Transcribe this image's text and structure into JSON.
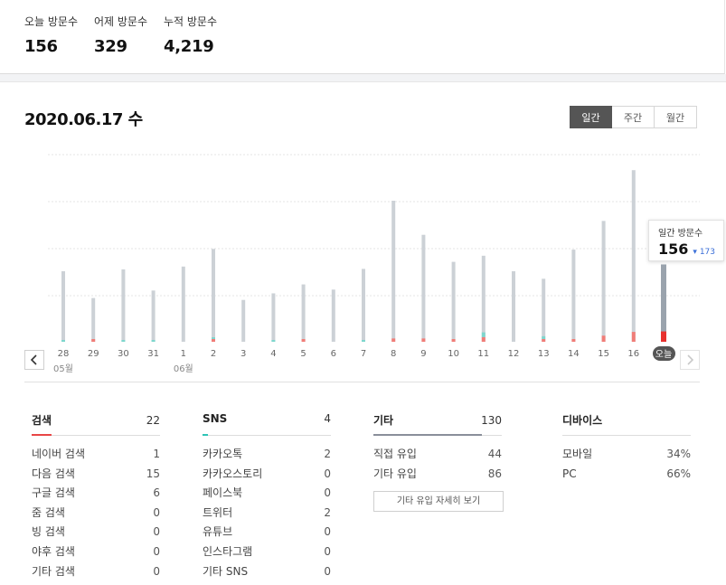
{
  "summary": {
    "today_label": "오늘 방문수",
    "today_value": "156",
    "yesterday_label": "어제 방문수",
    "yesterday_value": "329",
    "total_label": "누적 방문수",
    "total_value": "4,219"
  },
  "date_title": "2020.06.17 수",
  "period_tabs": [
    {
      "label": "일간",
      "active": true
    },
    {
      "label": "주간",
      "active": false
    },
    {
      "label": "월간",
      "active": false
    }
  ],
  "tooltip": {
    "label": "일간 방문수",
    "value": "156",
    "delta": "173",
    "delta_icon": "caret-down-icon"
  },
  "colors": {
    "bar_total": "#ccd1d6",
    "bar_today": "#9aa3ad",
    "bar_red": "#f07d78",
    "bar_red_today": "#e8312e",
    "bar_teal": "#7fd6cd",
    "accent_search": "#e84646",
    "accent_sns": "#2ec4b6",
    "accent_other": "#8a8f9a"
  },
  "chart_data": {
    "type": "bar",
    "categories": [
      "28",
      "29",
      "30",
      "31",
      "1",
      "2",
      "3",
      "4",
      "5",
      "6",
      "7",
      "8",
      "9",
      "10",
      "11",
      "12",
      "13",
      "14",
      "15",
      "16",
      "오늘"
    ],
    "month_labels": [
      {
        "label": "05월",
        "index": 0
      },
      {
        "label": "06월",
        "index": 4
      }
    ],
    "highlight_index": 20,
    "series": [
      {
        "values": [
          300,
          186,
          308,
          218,
          320,
          395,
          178,
          206,
          244,
          222,
          310,
          600,
          455,
          340,
          366,
          300,
          268,
          392,
          514,
          730,
          329
        ]
      },
      {
        "values": [
          0,
          6,
          0,
          0,
          0,
          8,
          0,
          0,
          6,
          0,
          0,
          14,
          14,
          6,
          20,
          0,
          10,
          6,
          26,
          42,
          44
        ]
      },
      {
        "values": [
          3,
          0,
          4,
          6,
          0,
          6,
          0,
          2,
          0,
          0,
          6,
          0,
          0,
          0,
          20,
          0,
          12,
          0,
          0,
          0,
          0
        ]
      }
    ]
  },
  "search": {
    "title": "검색",
    "total": "22",
    "items": [
      {
        "label": "네이버 검색",
        "value": "1"
      },
      {
        "label": "다음 검색",
        "value": "15"
      },
      {
        "label": "구글 검색",
        "value": "6"
      },
      {
        "label": "줌 검색",
        "value": "0"
      },
      {
        "label": "빙 검색",
        "value": "0"
      },
      {
        "label": "야후 검색",
        "value": "0"
      },
      {
        "label": "기타 검색",
        "value": "0"
      }
    ]
  },
  "sns": {
    "title": "SNS",
    "total": "4",
    "items": [
      {
        "label": "카카오톡",
        "value": "2"
      },
      {
        "label": "카카오스토리",
        "value": "0"
      },
      {
        "label": "페이스북",
        "value": "0"
      },
      {
        "label": "트위터",
        "value": "2"
      },
      {
        "label": "유튜브",
        "value": "0"
      },
      {
        "label": "인스타그램",
        "value": "0"
      },
      {
        "label": "기타 SNS",
        "value": "0"
      }
    ]
  },
  "other": {
    "title": "기타",
    "total": "130",
    "items": [
      {
        "label": "직접 유입",
        "value": "44"
      },
      {
        "label": "기타 유입",
        "value": "86"
      }
    ],
    "detail_button": "기타 유입 자세히 보기"
  },
  "device": {
    "title": "디바이스",
    "items": [
      {
        "label": "모바일",
        "value": "34%"
      },
      {
        "label": "PC",
        "value": "66%"
      }
    ]
  }
}
